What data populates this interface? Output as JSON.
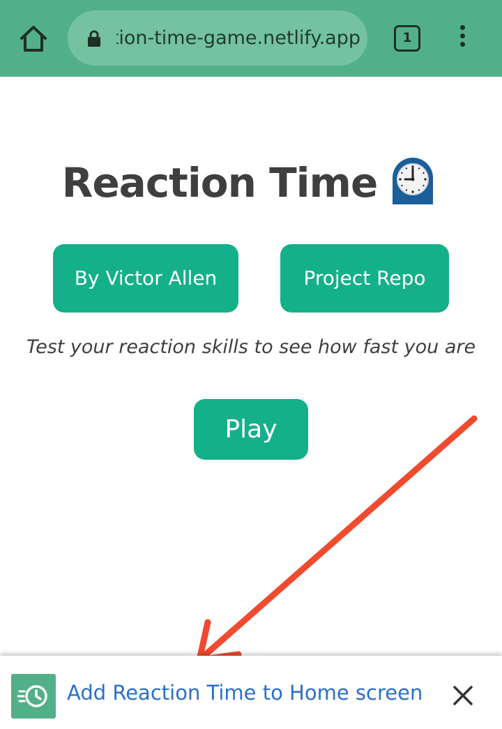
{
  "browser": {
    "url": "reaction-time-game.netlify.app",
    "tab_count": "1",
    "home_icon": "home-icon",
    "lock_icon": "lock-icon",
    "menu_icon": "more-vert-icon",
    "toolbar_color": "#52b088"
  },
  "page": {
    "title": "Reaction Time",
    "title_icon": "alarm-clock-icon",
    "author_button": "By Victor Allen",
    "repo_button": "Project Repo",
    "tagline": "Test your reaction skills to see how fast you are",
    "play_button": "Play",
    "button_color": "#14b08a",
    "text_color": "#3f3f3f"
  },
  "annotation": {
    "arrow_color": "#f04a2f"
  },
  "install_banner": {
    "text": "Add Reaction Time to Home screen",
    "app_icon": "app-clock-icon",
    "close_icon": "close-icon",
    "text_color": "#2a6fc9"
  }
}
